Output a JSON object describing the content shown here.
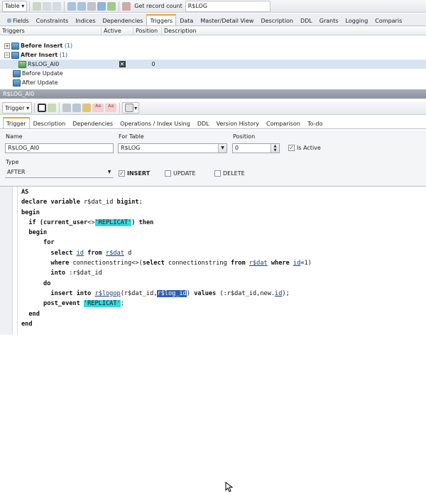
{
  "toolbar": {
    "table_label": "Table",
    "get_record_count": "Get record count",
    "object_name": "R$LOG"
  },
  "top_tabs": [
    "Fields",
    "Constraints",
    "Indices",
    "Dependencies",
    "Triggers",
    "Data",
    "Master/Detail View",
    "Description",
    "DDL",
    "Grants",
    "Logging",
    "Comparis"
  ],
  "grid": {
    "headers": [
      "Triggers",
      "Active",
      "Position",
      "Description"
    ],
    "rows": [
      {
        "name": "Before Insert",
        "count": "(1)"
      },
      {
        "name": "After Insert",
        "count": "(1)"
      },
      {
        "name": "R$LOG_AI0",
        "position": "0"
      },
      {
        "name": "Before Update"
      },
      {
        "name": "After Update"
      }
    ]
  },
  "panel_title": "R$LOG_AI0",
  "trigger_toolbar": {
    "label": "Trigger"
  },
  "sub_tabs": [
    "Trigger",
    "Description",
    "Dependencies",
    "Operations / Index Using",
    "DDL",
    "Version History",
    "Comparison",
    "To-do"
  ],
  "form": {
    "name_label": "Name",
    "name_value": "R$LOG_AI0",
    "table_label": "For Table",
    "table_value": "R$LOG",
    "position_label": "Position",
    "position_value": "0",
    "is_active_label": "Is Active",
    "type_label": "Type",
    "type_value": "AFTER",
    "insert_label": "INSERT",
    "update_label": "UPDATE",
    "delete_label": "DELETE"
  },
  "code": [
    {
      "t": [
        {
          "s": "AS",
          "k": "kw"
        }
      ]
    },
    {
      "t": [
        {
          "s": "declare variable",
          "k": "kw"
        },
        {
          "s": " r$dat_id "
        },
        {
          "s": "bigint",
          "k": "kw"
        },
        {
          "s": ";"
        }
      ]
    },
    {
      "t": [
        {
          "s": "begin",
          "k": "kw"
        }
      ]
    },
    {
      "t": [
        {
          "s": "  if (",
          "k": "kw"
        },
        {
          "s": "current_user",
          "k": "kw"
        },
        {
          "s": "<>"
        },
        {
          "s": "'REPLICAT'",
          "k": "str"
        },
        {
          "s": ") then",
          "k": "kw"
        }
      ]
    },
    {
      "t": [
        {
          "s": "  begin",
          "k": "kw"
        }
      ]
    },
    {
      "t": [
        {
          "s": "      for",
          "k": "kw"
        }
      ]
    },
    {
      "t": [
        {
          "s": "        select ",
          "k": "kw"
        },
        {
          "s": "id",
          "k": "ul"
        },
        {
          "s": " from ",
          "k": "kw"
        },
        {
          "s": "r$dat",
          "k": "ul"
        },
        {
          "s": " d"
        }
      ]
    },
    {
      "t": [
        {
          "s": "        where ",
          "k": "kw"
        },
        {
          "s": "connectionstring<>("
        },
        {
          "s": "select ",
          "k": "kw"
        },
        {
          "s": "connectionstring "
        },
        {
          "s": "from ",
          "k": "kw"
        },
        {
          "s": "r$dat",
          "k": "ul"
        },
        {
          "s": " where ",
          "k": "kw"
        },
        {
          "s": "id",
          "k": "ul"
        },
        {
          "s": "=1)"
        }
      ]
    },
    {
      "t": [
        {
          "s": "        into ",
          "k": "kw"
        },
        {
          "s": ":r$dat_id"
        }
      ]
    },
    {
      "t": [
        {
          "s": "      do",
          "k": "kw"
        }
      ]
    },
    {
      "t": [
        {
          "s": "        insert into ",
          "k": "kw"
        },
        {
          "s": "r$logop",
          "k": "ul"
        },
        {
          "s": "(r$dat_id,"
        },
        {
          "s": "r$log_id",
          "k": "sel"
        },
        {
          "s": ") "
        },
        {
          "s": "values ",
          "k": "kw"
        },
        {
          "s": "(:r$dat_id,new."
        },
        {
          "s": "id",
          "k": "ul"
        },
        {
          "s": ");"
        }
      ]
    },
    {
      "t": [
        {
          "s": "      post_event ",
          "k": "kw"
        },
        {
          "s": "'REPLICAT'",
          "k": "str"
        },
        {
          "s": ";"
        }
      ]
    },
    {
      "t": [
        {
          "s": "  end",
          "k": "kw"
        }
      ]
    },
    {
      "t": [
        {
          "s": "end",
          "k": "kw"
        }
      ]
    }
  ]
}
